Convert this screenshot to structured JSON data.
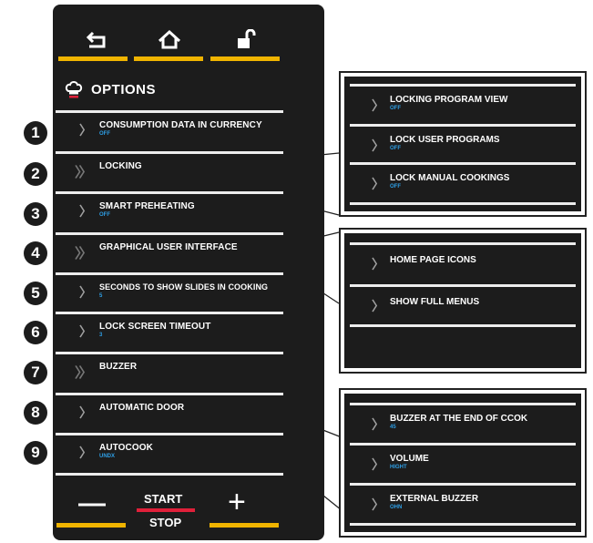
{
  "header": {
    "title": "OPTIONS"
  },
  "top_icons": [
    {
      "name": "back-icon"
    },
    {
      "name": "home-icon"
    },
    {
      "name": "unlock-icon"
    }
  ],
  "options": [
    {
      "number": "1",
      "label": "CONSUMPTION DATA IN CURRENCY",
      "value": "OFF"
    },
    {
      "number": "2",
      "label": "LOCKING",
      "value": ""
    },
    {
      "number": "3",
      "label": "SMART PREHEATING",
      "value": "OFF"
    },
    {
      "number": "4",
      "label": "GRAPHICAL USER INTERFACE",
      "value": ""
    },
    {
      "number": "5",
      "label": "SECONDS TO SHOW SLIDES IN COOKING",
      "value": "5"
    },
    {
      "number": "6",
      "label": "LOCK SCREEN TIMEOUT",
      "value": "3"
    },
    {
      "number": "7",
      "label": "BUZZER",
      "value": ""
    },
    {
      "number": "8",
      "label": "AUTOMATIC DOOR",
      "value": ""
    },
    {
      "number": "9",
      "label": "AUTOCOOK",
      "value": "UNDX"
    }
  ],
  "bottom": {
    "minus": "—",
    "plus": "+",
    "start": "START",
    "stop": "STOP"
  },
  "callouts": {
    "locking": [
      {
        "label": "LOCKING PROGRAM VIEW",
        "value": "OFF"
      },
      {
        "label": "LOCK USER PROGRAMS",
        "value": "OFF"
      },
      {
        "label": "LOCK MANUAL COOKINGS",
        "value": "OFF"
      }
    ],
    "gui": [
      {
        "label": "HOME PAGE ICONS",
        "value": ""
      },
      {
        "label": "SHOW FULL MENUS",
        "value": ""
      }
    ],
    "buzzer": [
      {
        "label": "BUZZER AT THE END OF CCOK",
        "value": "45"
      },
      {
        "label": "VOLUME",
        "value": "HIGHT"
      },
      {
        "label": "EXTERNAL BUZZER",
        "value": "OHN"
      }
    ]
  },
  "colors": {
    "accent": "#f0b400",
    "value_blue": "#2e9fe6",
    "panel": "#1c1c1c",
    "stop_red": "#e0203a"
  }
}
